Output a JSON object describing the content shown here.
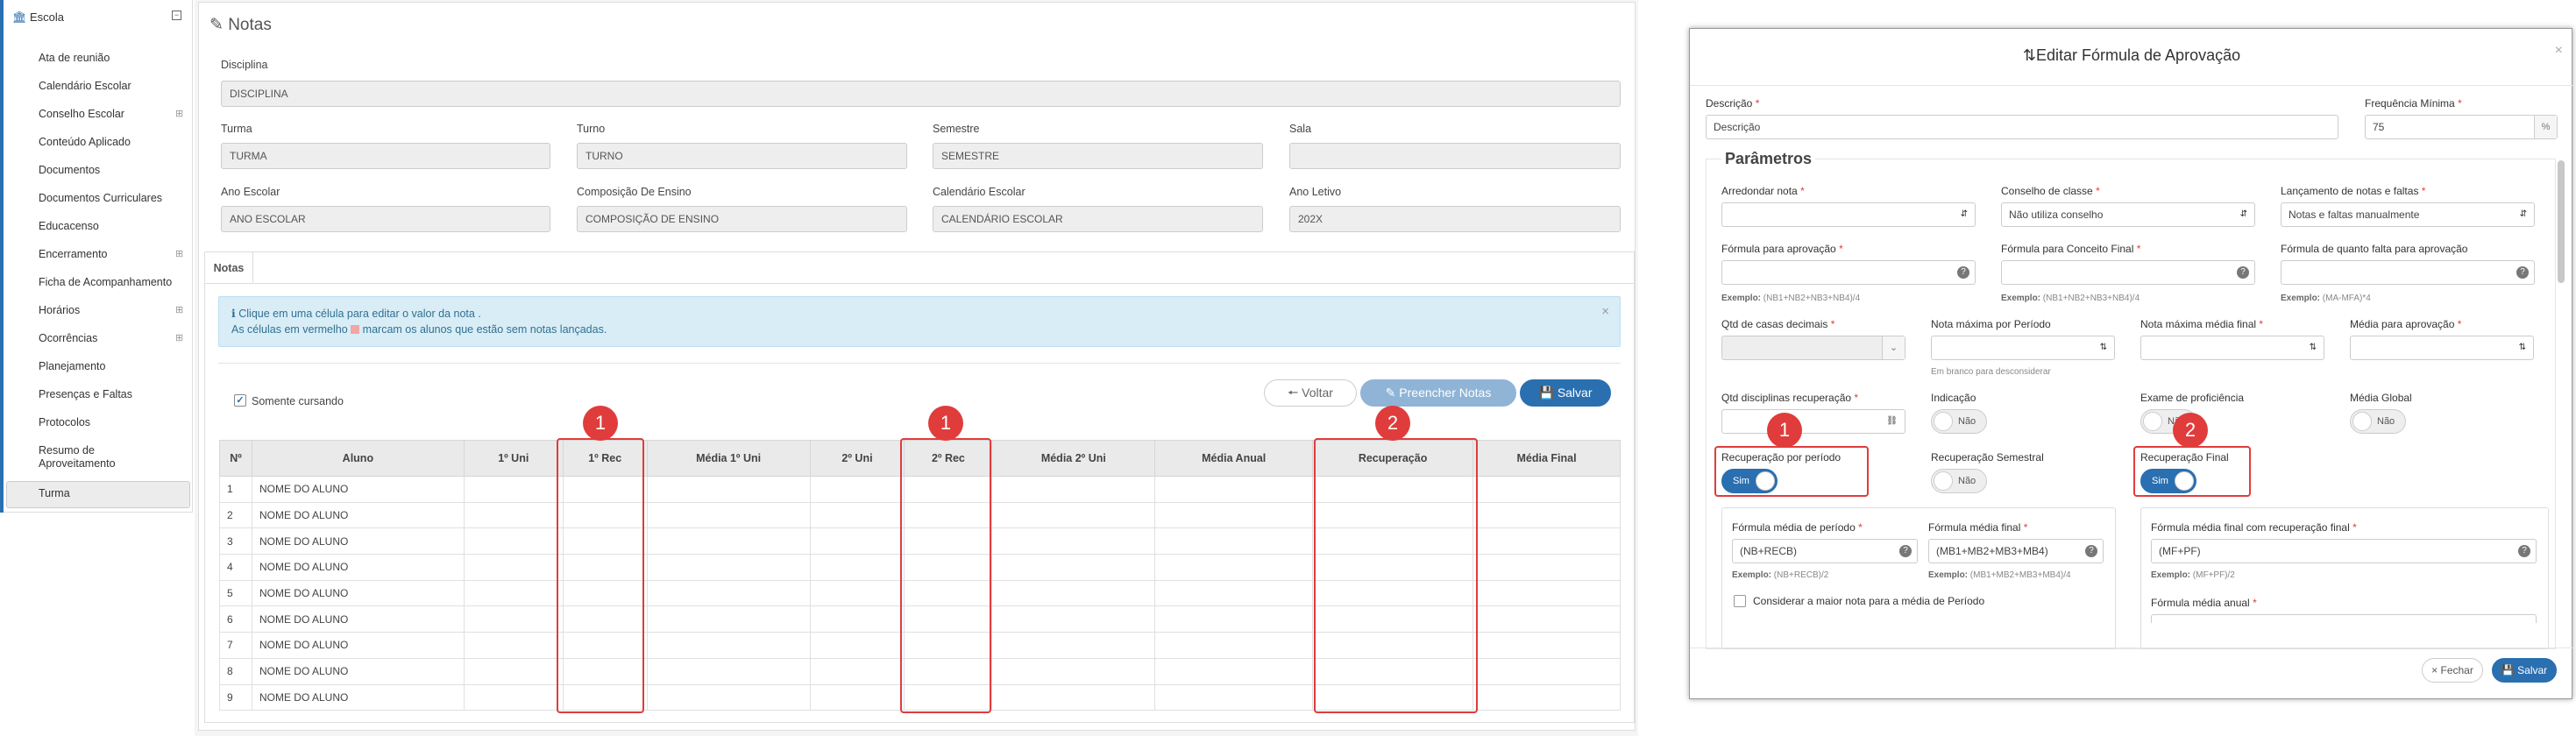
{
  "sidebar": {
    "header": "Escola",
    "items": [
      {
        "label": "Ata de reunião",
        "expand": false
      },
      {
        "label": "Calendário Escolar",
        "expand": false
      },
      {
        "label": "Conselho Escolar",
        "expand": true
      },
      {
        "label": "Conteúdo Aplicado",
        "expand": false
      },
      {
        "label": "Documentos",
        "expand": false
      },
      {
        "label": "Documentos Curriculares",
        "expand": false
      },
      {
        "label": "Educacenso",
        "expand": false
      },
      {
        "label": "Encerramento",
        "expand": true
      },
      {
        "label": "Ficha de Acompanhamento",
        "expand": false
      },
      {
        "label": "Horários",
        "expand": true
      },
      {
        "label": "Ocorrências",
        "expand": true
      },
      {
        "label": "Planejamento",
        "expand": false
      },
      {
        "label": "Presenças e Faltas",
        "expand": false
      },
      {
        "label": "Protocolos",
        "expand": false
      },
      {
        "label": "Resumo de",
        "expand": false
      },
      {
        "label": "Aproveitamento",
        "expand": false
      },
      {
        "label": "Turma",
        "expand": false
      }
    ]
  },
  "notas": {
    "title": "Notas",
    "fields": {
      "disciplina": {
        "label": "Disciplina",
        "value": "DISCIPLINA"
      },
      "turma": {
        "label": "Turma",
        "value": "TURMA"
      },
      "turno": {
        "label": "Turno",
        "value": "TURNO"
      },
      "semestre": {
        "label": "Semestre",
        "value": "SEMESTRE"
      },
      "sala": {
        "label": "Sala",
        "value": ""
      },
      "ano_escolar": {
        "label": "Ano Escolar",
        "value": "ANO ESCOLAR"
      },
      "composicao": {
        "label": "Composição De Ensino",
        "value": "COMPOSIÇÃO DE ENSINO"
      },
      "calendario": {
        "label": "Calendário Escolar",
        "value": "CALENDÁRIO ESCOLAR"
      },
      "ano_letivo": {
        "label": "Ano Letivo",
        "value": "202X"
      }
    },
    "tab": "Notas",
    "alert_line1": "Clique em uma célula para editar o valor da nota .",
    "alert_line2a": "As células em vermelho",
    "alert_line2b": "marcam os alunos que estão sem notas lançadas.",
    "only_current_label": "Somente cursando",
    "buttons": {
      "voltar": "Voltar",
      "preencher": "Preencher Notas",
      "salvar": "Salvar"
    },
    "columns": [
      "Nº",
      "Aluno",
      "1º Uni",
      "1º Rec",
      "Média 1º Uni",
      "2º Uni",
      "2º Rec",
      "Média 2º Uni",
      "Média Anual",
      "Recuperação",
      "Média Final"
    ],
    "rows": [
      {
        "n": "1",
        "aluno": "NOME DO ALUNO"
      },
      {
        "n": "2",
        "aluno": "NOME DO ALUNO"
      },
      {
        "n": "3",
        "aluno": "NOME DO ALUNO"
      },
      {
        "n": "4",
        "aluno": "NOME DO ALUNO"
      },
      {
        "n": "5",
        "aluno": "NOME DO ALUNO"
      },
      {
        "n": "6",
        "aluno": "NOME DO ALUNO"
      },
      {
        "n": "7",
        "aluno": "NOME DO ALUNO"
      },
      {
        "n": "8",
        "aluno": "NOME DO ALUNO"
      },
      {
        "n": "9",
        "aluno": "NOME DO ALUNO"
      }
    ],
    "badges": [
      "1",
      "1",
      "2"
    ]
  },
  "modal": {
    "title": "Editar Fórmula de Aprovação",
    "descricao": {
      "label": "Descrição",
      "value": "Descrição"
    },
    "frequencia": {
      "label": "Frequência Mínima",
      "value": "75",
      "suffix": "%"
    },
    "parametros": "Parâmetros",
    "arredondar": {
      "label": "Arredondar nota",
      "value": ""
    },
    "conselho": {
      "label": "Conselho de classe",
      "value": "Não utiliza conselho"
    },
    "lancamento": {
      "label": "Lançamento de notas e faltas",
      "value": "Notas e faltas manualmente"
    },
    "formula_aprov": {
      "label": "Fórmula para aprovação",
      "example_label": "Exemplo:",
      "example": "(NB1+NB2+NB3+NB4)/4"
    },
    "formula_conceito": {
      "label": "Fórmula para Conceito Final",
      "example_label": "Exemplo:",
      "example": "(NB1+NB2+NB3+NB4)/4"
    },
    "formula_falta": {
      "label": "Fórmula de quanto falta para aprovação",
      "example_label": "Exemplo:",
      "example": "(MA-MFA)*4"
    },
    "casas": {
      "label": "Qtd de casas decimais"
    },
    "nota_max_periodo": {
      "label": "Nota máxima por Período",
      "hint": "Em branco para desconsiderar"
    },
    "nota_max_final": {
      "label": "Nota máxima média final"
    },
    "media_aprov": {
      "label": "Média para aprovação"
    },
    "qtd_disc_rec": {
      "label": "Qtd disciplinas recuperação"
    },
    "indicacao": {
      "label": "Indicação",
      "value": "Não"
    },
    "exame": {
      "label": "Exame de proficiência",
      "value": "Não"
    },
    "media_global": {
      "label": "Média Global",
      "value": "Não"
    },
    "rec_periodo": {
      "label": "Recuperação por período",
      "value": "Sim"
    },
    "rec_semestral": {
      "label": "Recuperação Semestral",
      "value": "Não"
    },
    "rec_final": {
      "label": "Recuperação Final",
      "value": "Sim"
    },
    "formula_media_periodo": {
      "label": "Fórmula média de período",
      "value": "(NB+RECB)",
      "example_label": "Exemplo:",
      "example": "(NB+RECB)/2"
    },
    "formula_media_final": {
      "label": "Fórmula média final",
      "value": "(MB1+MB2+MB3+MB4)",
      "example_label": "Exemplo:",
      "example": "(MB1+MB2+MB3+MB4)/4"
    },
    "considerar": "Considerar a maior nota para a média de Período",
    "formula_final_rec": {
      "label": "Fórmula média final com recuperação final",
      "value": "(MF+PF)",
      "example_label": "Exemplo:",
      "example": "(MF+PF)/2"
    },
    "formula_anual": {
      "label": "Fórmula média anual"
    },
    "badges": [
      "1",
      "2"
    ],
    "btn_fechar": "Fechar",
    "btn_salvar": "Salvar"
  },
  "colors": {
    "accent": "#2a6fb0",
    "annotation": "#e03c3c",
    "alert_bg": "#d9edf7"
  },
  "icons": [
    "bank-icon",
    "edit-icon",
    "info-icon",
    "arrow-left-icon",
    "pencil-icon",
    "save-icon",
    "sort-icon",
    "close-icon"
  ]
}
